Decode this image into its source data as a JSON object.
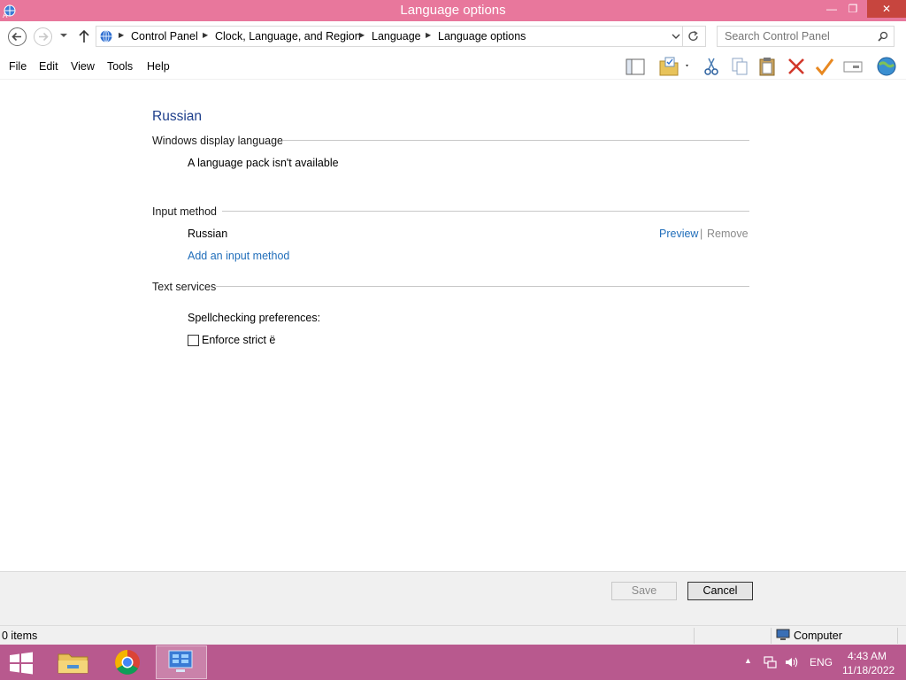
{
  "window": {
    "title": "Language options",
    "min_glyph": "—",
    "max_glyph": "❐",
    "close_glyph": "✕"
  },
  "address": {
    "crumbs": [
      "Control Panel",
      "Clock, Language, and Region",
      "Language",
      "Language options"
    ],
    "separator": "▶"
  },
  "search": {
    "placeholder": "Search Control Panel"
  },
  "menu": [
    "File",
    "Edit",
    "View",
    "Tools",
    "Help"
  ],
  "toolbar_icons": [
    "layout-pane-icon",
    "folder-options-icon",
    "cut-icon",
    "copy-icon",
    "paste-icon",
    "delete-icon",
    "properties-check-icon",
    "rename-icon",
    "globe-icon"
  ],
  "content": {
    "language_name": "Russian",
    "display_section": {
      "heading": "Windows display language",
      "status": "A language pack isn't available"
    },
    "input_section": {
      "heading": "Input method",
      "method_name": "Russian",
      "preview_label": "Preview",
      "separator": "|",
      "remove_label": "Remove",
      "add_label": "Add an input method"
    },
    "text_services": {
      "heading": "Text services",
      "spellcheck_label": "Spellchecking preferences:",
      "enforce_label": "Enforce strict ё",
      "enforce_checked": false
    }
  },
  "footer": {
    "save_label": "Save",
    "cancel_label": "Cancel"
  },
  "status": {
    "items": "0 items",
    "zone": "Computer"
  },
  "taskbar": {
    "apps": [
      "file-explorer",
      "chrome",
      "control-panel"
    ],
    "language": "ENG",
    "time": "4:43 AM",
    "date": "11/18/2022",
    "tray_arrow": "▲"
  },
  "colors": {
    "titlebar": "#e8779c",
    "taskbar": "#b8598e",
    "link": "#1f6dba",
    "heading": "#1e3f8c"
  }
}
